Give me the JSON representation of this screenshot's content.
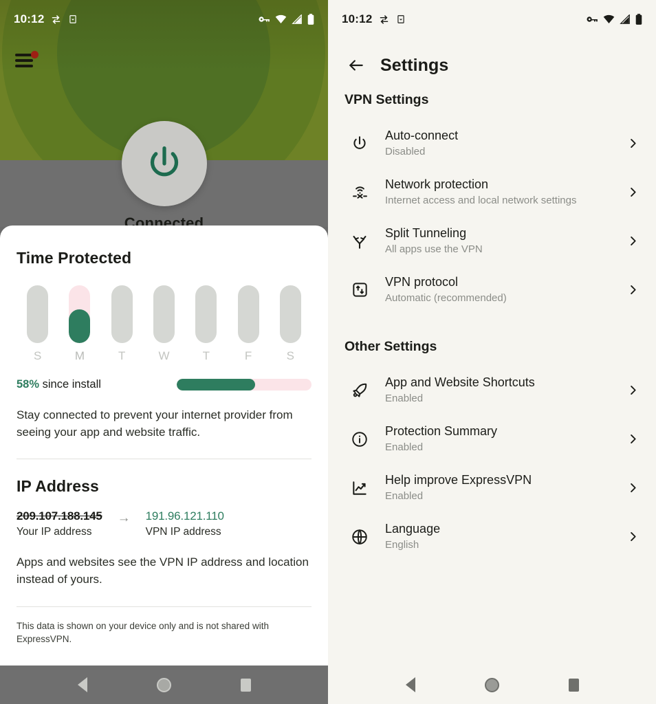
{
  "status_bar": {
    "time": "10:12",
    "left_icons": [
      "vpn-key-swap-icon",
      "device-download-icon"
    ],
    "right_icons": [
      "vpn-key-icon",
      "wifi-icon",
      "cellular-signal-icon",
      "battery-icon"
    ]
  },
  "home": {
    "menu_icon": "hamburger-menu-icon",
    "notification_badge": true,
    "power_icon": "power-icon",
    "connection_status": "Connected",
    "time_protected": {
      "heading": "Time Protected",
      "stat_percent": "58%",
      "stat_suffix": " since install",
      "description": "Stay connected to prevent your internet provider from seeing your app and website traffic."
    },
    "ip_address": {
      "heading": "IP Address",
      "your_ip": "209.107.188.145",
      "your_ip_caption": "Your IP address",
      "arrow": "→",
      "vpn_ip": "191.96.121.110",
      "vpn_ip_caption": "VPN IP address",
      "description": "Apps and websites see the VPN IP address and location instead of yours."
    },
    "footnote": "This data is shown on your device only and is not shared with ExpressVPN."
  },
  "chart_data": {
    "type": "bar",
    "title": "Time Protected",
    "categories": [
      "S",
      "M",
      "T",
      "W",
      "T",
      "F",
      "S"
    ],
    "values": [
      0,
      58,
      0,
      0,
      0,
      0,
      0
    ],
    "active_index": 1,
    "ylim": [
      0,
      100
    ],
    "ylabel": "",
    "xlabel": "",
    "grid": false,
    "legend": "none",
    "bar_track_color": "#d5d7d3",
    "bar_active_track_color": "#fbe4e8",
    "bar_fill_color": "#2e7d5f",
    "progress": {
      "type": "bar",
      "label": "58% since install",
      "value": 58,
      "max": 100,
      "fill_color": "#2e7d5f",
      "track_color": "#fbe4e8"
    }
  },
  "settings": {
    "back_icon": "arrow-left-icon",
    "title": "Settings",
    "sections": [
      {
        "title": "VPN Settings",
        "items": [
          {
            "icon": "power-icon",
            "title": "Auto-connect",
            "subtitle": "Disabled"
          },
          {
            "icon": "network-protection-icon",
            "title": "Network protection",
            "subtitle": "Internet access and local network settings"
          },
          {
            "icon": "split-tunneling-icon",
            "title": "Split Tunneling",
            "subtitle": "All apps use the VPN"
          },
          {
            "icon": "vpn-protocol-icon",
            "title": "VPN protocol",
            "subtitle": "Automatic (recommended)"
          }
        ]
      },
      {
        "title": "Other Settings",
        "items": [
          {
            "icon": "rocket-icon",
            "title": "App and Website Shortcuts",
            "subtitle": "Enabled"
          },
          {
            "icon": "info-icon",
            "title": "Protection Summary",
            "subtitle": "Enabled"
          },
          {
            "icon": "chart-line-icon",
            "title": "Help improve ExpressVPN",
            "subtitle": "Enabled"
          },
          {
            "icon": "globe-icon",
            "title": "Language",
            "subtitle": "English"
          }
        ]
      }
    ]
  },
  "nav_bar": {
    "back": "back-triangle-icon",
    "home": "home-circle-icon",
    "recents": "recents-square-icon"
  },
  "colors": {
    "brand_green": "#2e7d5f",
    "hero_olive": "#6c7a24",
    "pink_track": "#fbe4e8",
    "right_bg": "#f6f5f0",
    "notification_red": "#9e1f14"
  }
}
